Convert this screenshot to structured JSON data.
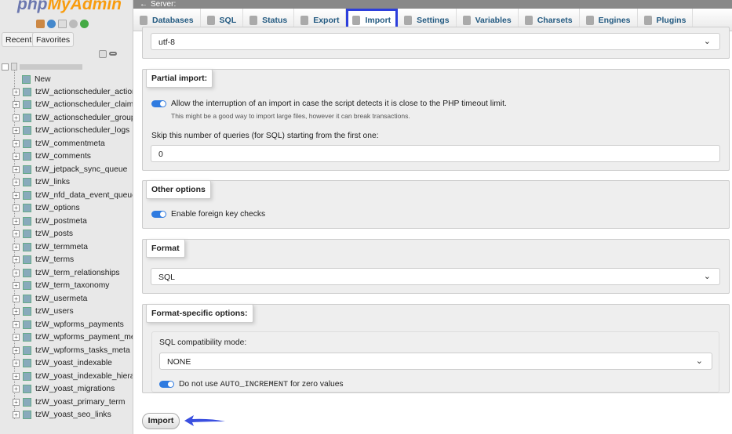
{
  "sidebar": {
    "logo_a": "php",
    "logo_b": "MyAdmin",
    "recent": "Recent",
    "favorites": "Favorites",
    "new": "New",
    "tables": [
      "tzW_actionscheduler_actions",
      "tzW_actionscheduler_claims",
      "tzW_actionscheduler_groups",
      "tzW_actionscheduler_logs",
      "tzW_commentmeta",
      "tzW_comments",
      "tzW_jetpack_sync_queue",
      "tzW_links",
      "tzW_nfd_data_event_queue",
      "tzW_options",
      "tzW_postmeta",
      "tzW_posts",
      "tzW_termmeta",
      "tzW_terms",
      "tzW_term_relationships",
      "tzW_term_taxonomy",
      "tzW_usermeta",
      "tzW_users",
      "tzW_wpforms_payments",
      "tzW_wpforms_payment_meta",
      "tzW_wpforms_tasks_meta",
      "tzW_yoast_indexable",
      "tzW_yoast_indexable_hierarchy",
      "tzW_yoast_migrations",
      "tzW_yoast_primary_term",
      "tzW_yoast_seo_links"
    ]
  },
  "topbar": {
    "server": "Server:"
  },
  "tabs": [
    "Databases",
    "SQL",
    "Status",
    "Export",
    "Import",
    "Settings",
    "Variables",
    "Charsets",
    "Engines",
    "Plugins"
  ],
  "active_tab": "Import",
  "highlight_color": "#2d3fdc",
  "charset": {
    "value": "utf-8"
  },
  "partial": {
    "legend": "Partial import:",
    "allow": "Allow the interruption of an import in case the script detects it is close to the PHP timeout limit.",
    "hint": "This might be a good way to import large files, however it can break transactions.",
    "skip_label": "Skip this number of queries (for SQL) starting from the first one:",
    "skip_value": "0",
    "allow_on": true
  },
  "other": {
    "legend": "Other options",
    "fk": "Enable foreign key checks",
    "fk_on": true
  },
  "format": {
    "legend": "Format",
    "value": "SQL"
  },
  "specific": {
    "legend": "Format-specific options:",
    "compat_label": "SQL compatibility mode:",
    "compat_value": "NONE",
    "auto_pre": "Do not use ",
    "auto_code": "AUTO_INCREMENT",
    "auto_post": " for zero values",
    "auto_on": true
  },
  "import_button": "Import"
}
